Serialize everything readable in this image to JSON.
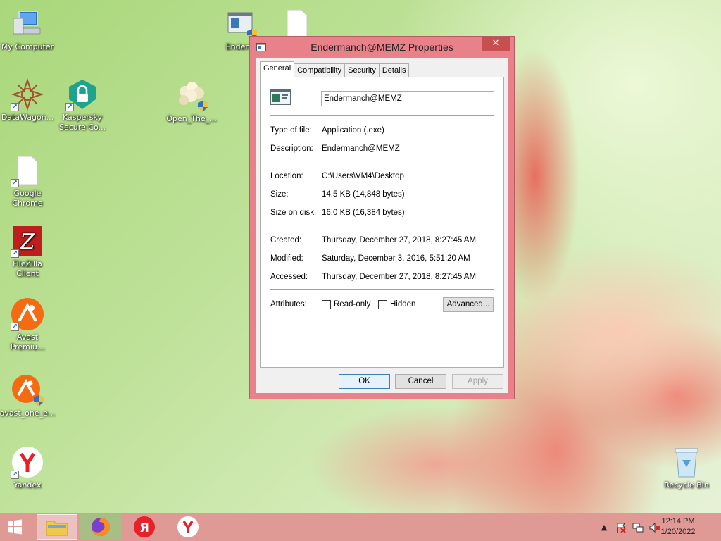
{
  "desktop": {
    "icons": [
      {
        "label": "My Computer"
      },
      {
        "label": "DataWagon..."
      },
      {
        "label": "Kaspersky Secure Co..."
      },
      {
        "label": "Open_The_..."
      },
      {
        "label": "Google Chrome"
      },
      {
        "label": "FileZilla Client"
      },
      {
        "label": "Avast Premiu..."
      },
      {
        "label": "avast_one_e..."
      },
      {
        "label": "Yandex"
      },
      {
        "label": "Recycle Bin"
      },
      {
        "label": "Enderm"
      }
    ]
  },
  "dialog": {
    "title": "Endermanch@MEMZ Properties",
    "close_label": "✕",
    "tabs": [
      {
        "label": "General"
      },
      {
        "label": "Compatibility"
      },
      {
        "label": "Security"
      },
      {
        "label": "Details"
      }
    ],
    "file_name": "Endermanch@MEMZ",
    "rows": {
      "type_label": "Type of file:",
      "type_value": "Application (.exe)",
      "desc_label": "Description:",
      "desc_value": "Endermanch@MEMZ",
      "location_label": "Location:",
      "location_value": "C:\\Users\\VM4\\Desktop",
      "size_label": "Size:",
      "size_value": "14.5 KB (14,848 bytes)",
      "disk_label": "Size on disk:",
      "disk_value": "16.0 KB (16,384 bytes)",
      "created_label": "Created:",
      "created_value": "Thursday, December 27, 2018, 8:27:45 AM",
      "modified_label": "Modified:",
      "modified_value": "Saturday, December 3, 2016, 5:51:20 AM",
      "accessed_label": "Accessed:",
      "accessed_value": "Thursday, December 27, 2018, 8:27:45 AM",
      "attributes_label": "Attributes:"
    },
    "readonly_label": "Read-only",
    "hidden_label": "Hidden",
    "advanced_label": "Advanced...",
    "ok_label": "OK",
    "cancel_label": "Cancel",
    "apply_label": "Apply"
  },
  "taskbar": {
    "clock_time": "12:14 PM",
    "clock_date": "1/20/2022",
    "tray_arrow": "▲"
  }
}
